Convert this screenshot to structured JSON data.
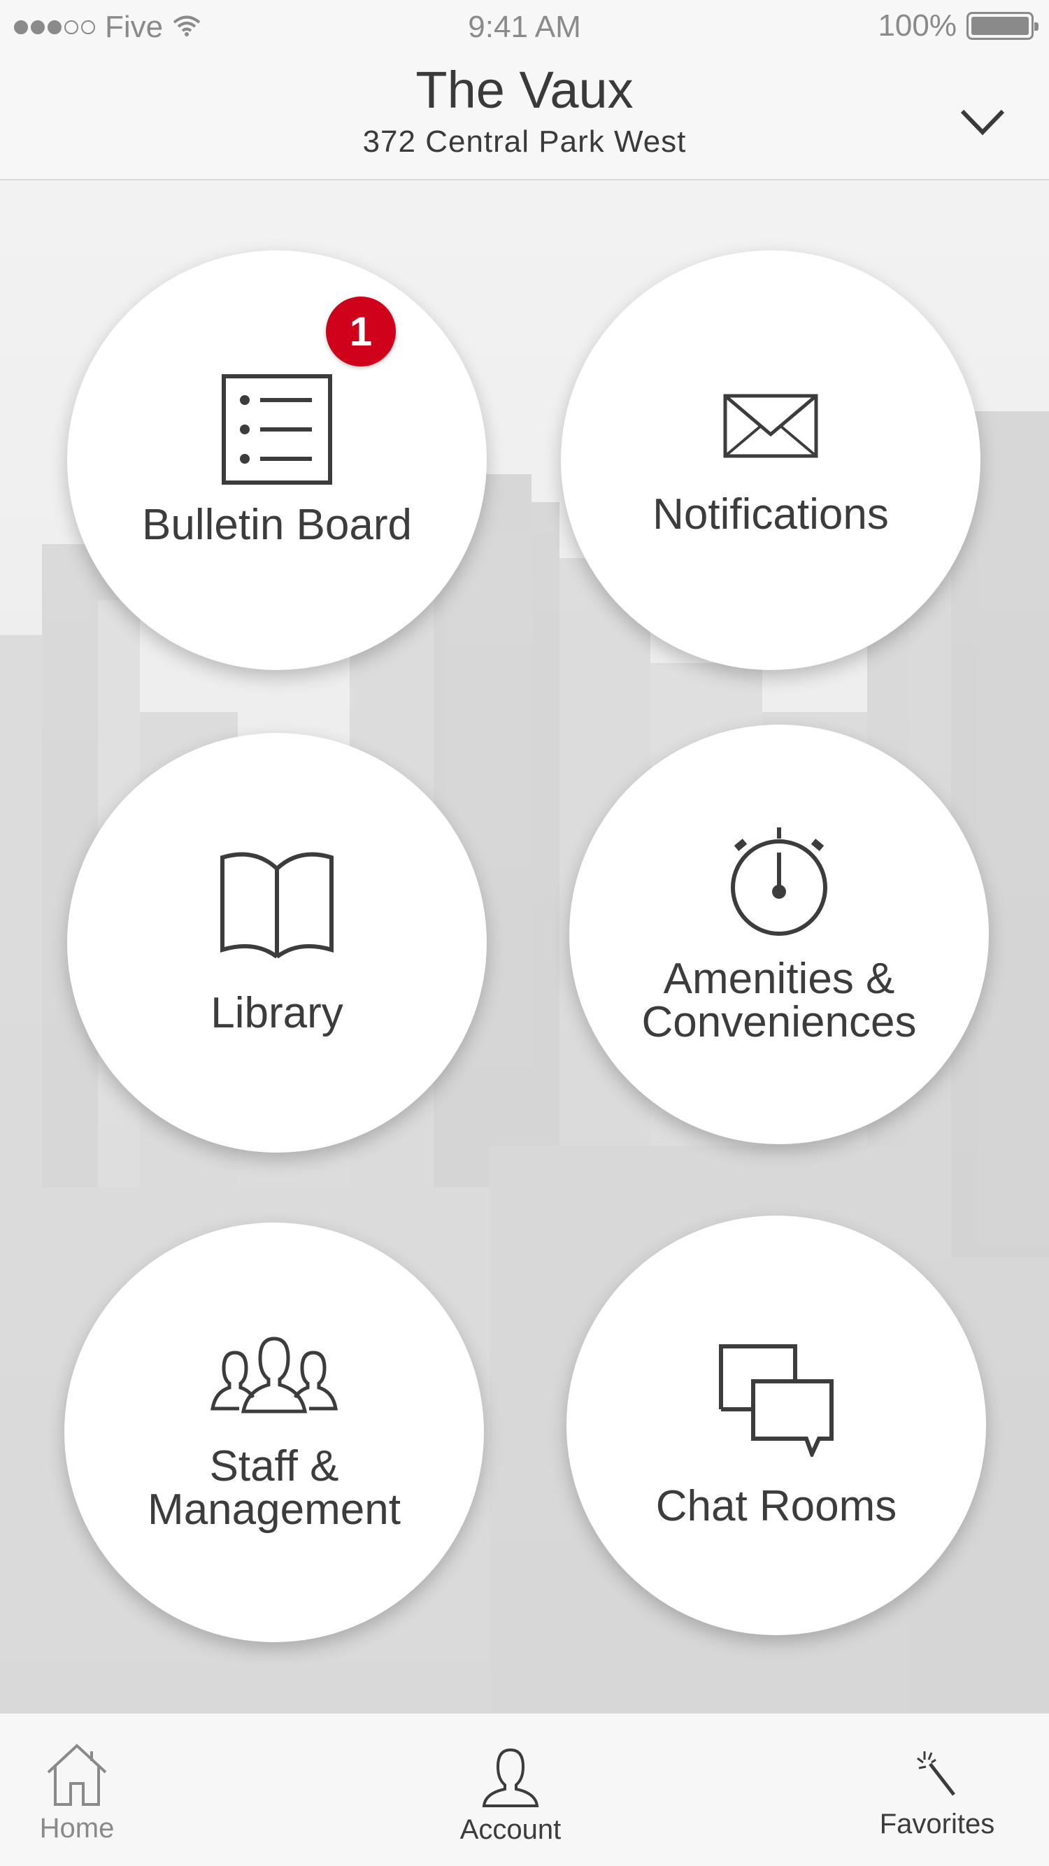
{
  "status_bar": {
    "carrier": "Five",
    "time": "9:41 AM",
    "battery": "100%",
    "signal_bars_filled": 3,
    "signal_bars_total": 5
  },
  "header": {
    "title": "The Vaux",
    "subtitle": "372 Central Park West",
    "dropdown_icon": "chevron-down-icon"
  },
  "tiles": {
    "bulletin": {
      "label": "Bulletin Board",
      "icon": "list-icon",
      "badge": "1"
    },
    "notifications": {
      "label": "Notifications",
      "icon": "envelope-icon"
    },
    "library": {
      "label": "Library",
      "icon": "book-icon"
    },
    "amenities": {
      "label_line1": "Amenities &",
      "label_line2": "Conveniences",
      "icon": "stopwatch-icon"
    },
    "staff": {
      "label_line1": "Staff &",
      "label_line2": "Management",
      "icon": "people-icon"
    },
    "chat": {
      "label": "Chat Rooms",
      "icon": "chat-bubbles-icon"
    }
  },
  "tab_bar": {
    "home": {
      "label": "Home",
      "icon": "home-icon"
    },
    "account": {
      "label": "Account",
      "icon": "person-icon"
    },
    "favorites": {
      "label": "Favorites",
      "icon": "magic-wand-icon"
    }
  },
  "colors": {
    "badge": "#d0021b",
    "text": "#3c3c3c",
    "inactive_tab": "#8a8a8a",
    "bars": "#f7f7f7"
  }
}
